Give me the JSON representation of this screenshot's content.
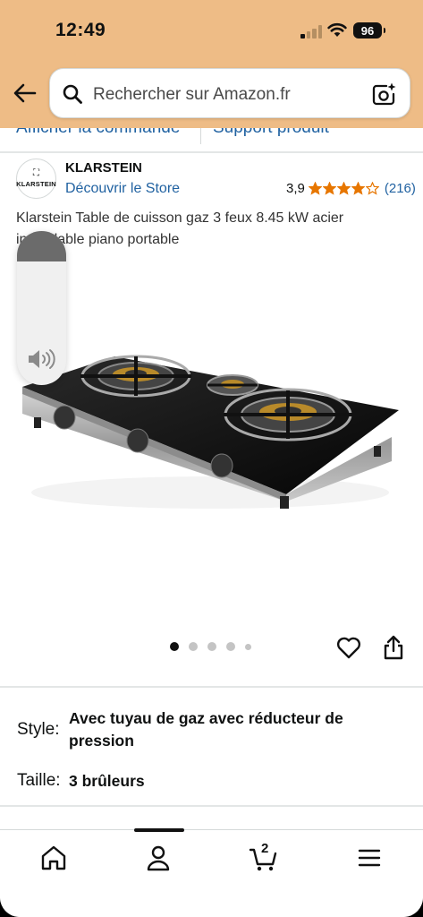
{
  "status_bar": {
    "time": "12:49",
    "battery": "96"
  },
  "search": {
    "placeholder": "Rechercher sur Amazon.fr"
  },
  "links": {
    "order": "Afficher la commande",
    "support": "Support produit"
  },
  "brand": {
    "logo_text": "KLARSTEIN",
    "name": "KLARSTEIN",
    "store_link": "Découvrir le Store",
    "rating_value": "3,9",
    "stars_out_of_5": 3.9,
    "rating_count": "(216)"
  },
  "product": {
    "title": "Klarstein Table de cuisson gaz 3 feux 8.45 kW acier inoxydable piano portable",
    "image_count": 5,
    "active_image": 1
  },
  "volume": {
    "level": 0.2
  },
  "variations": {
    "style_label": "Style:",
    "style_value": "Avec tuyau de gaz avec réducteur de pression",
    "size_label": "Taille:",
    "size_value": "3 brûleurs"
  },
  "bottom_nav": {
    "items": [
      "home-icon",
      "account-icon",
      "cart-icon",
      "menu-icon"
    ],
    "cart_count": "2"
  },
  "colors": {
    "header_bg": "#eebc86",
    "link": "#2162a1",
    "star": "#e77600"
  }
}
